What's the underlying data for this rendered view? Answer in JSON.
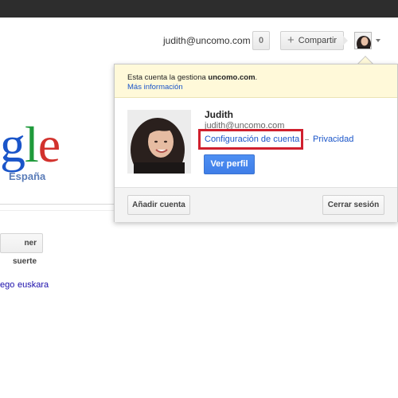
{
  "header": {
    "email": "judith@uncomo.com",
    "notifications_count": "0",
    "share_label": "Compartir"
  },
  "google": {
    "logo_partial_g": "g",
    "logo_partial_l": "l",
    "logo_partial_e": "e",
    "country": "España",
    "lucky_label": "ner suerte",
    "languages": [
      "ego",
      "euskara"
    ]
  },
  "account_popup": {
    "notice_text_prefix": "Esta cuenta la gestiona ",
    "notice_domain": "uncomo.com",
    "notice_text_suffix": ".",
    "notice_link": "Más información",
    "name": "Judith",
    "email": "judith@uncomo.com",
    "account_settings_link": "Configuración de cuenta",
    "privacy_link": "Privacidad",
    "view_profile_button": "Ver perfil",
    "add_account_button": "Añadir cuenta",
    "sign_out_button": "Cerrar sesión"
  },
  "colors": {
    "topbar": "#2d2d2d",
    "link_blue": "#1a55c9",
    "highlight_red": "#d0202e",
    "primary_button": "#4e8ff2",
    "notice_bg": "#fff9d9"
  }
}
